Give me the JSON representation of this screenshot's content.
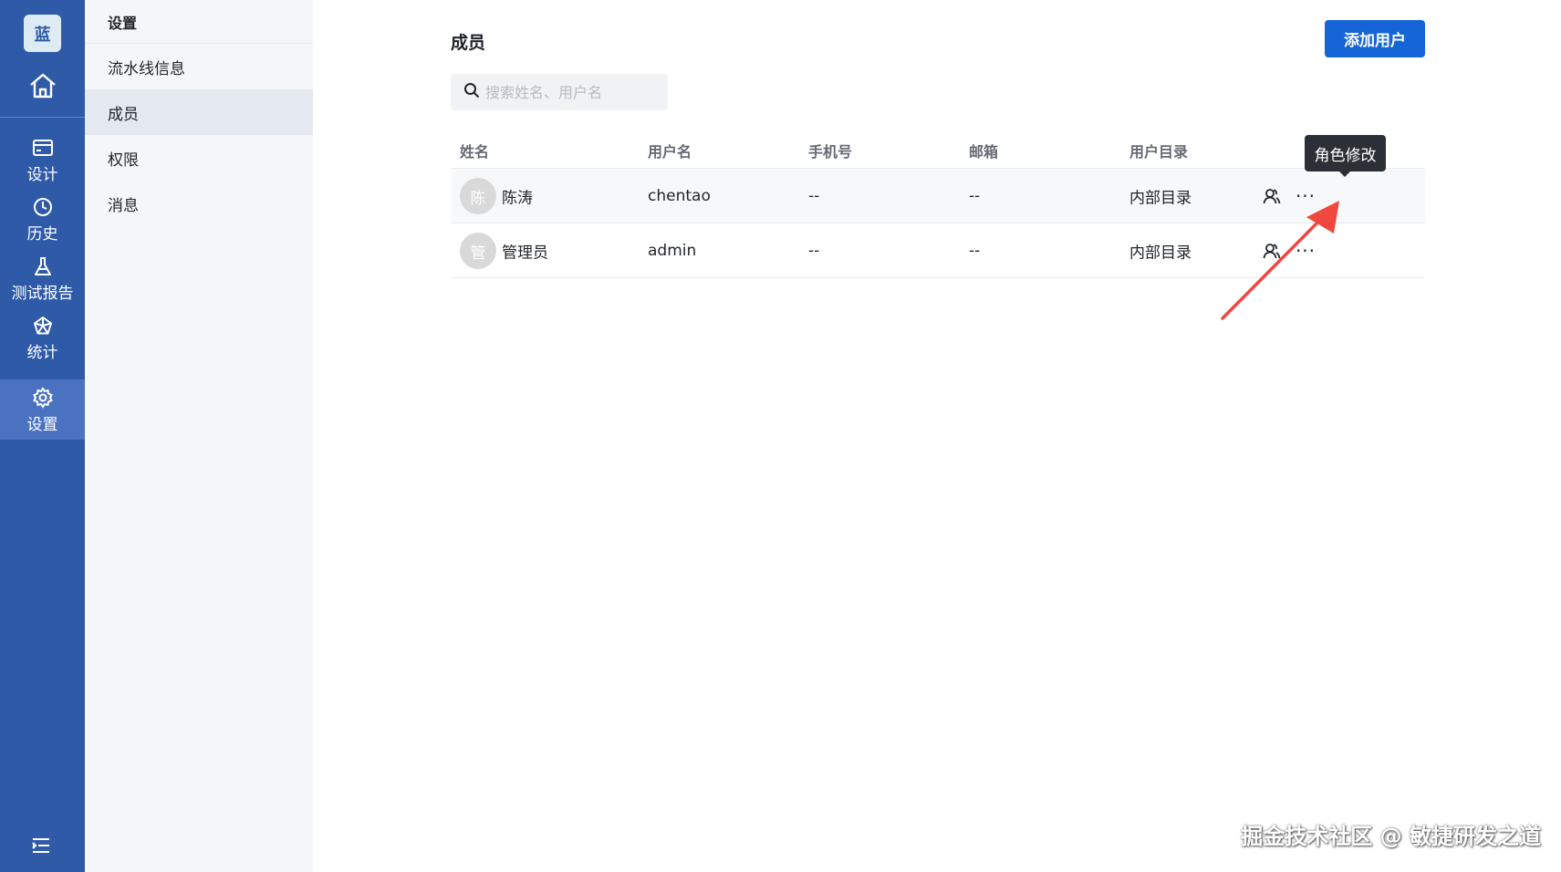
{
  "rail": {
    "logo": "蓝",
    "items": [
      {
        "label": "设计",
        "icon": "card-icon"
      },
      {
        "label": "历史",
        "icon": "clock-icon"
      },
      {
        "label": "测试报告",
        "icon": "flask-icon"
      },
      {
        "label": "统计",
        "icon": "pentagon-chart-icon"
      },
      {
        "label": "设置",
        "icon": "gear-icon",
        "active": true
      }
    ]
  },
  "sidebar": {
    "title": "设置",
    "items": [
      {
        "label": "流水线信息"
      },
      {
        "label": "成员",
        "active": true
      },
      {
        "label": "权限"
      },
      {
        "label": "消息"
      }
    ]
  },
  "main": {
    "title": "成员",
    "add_button": "添加用户",
    "search_placeholder": "搜索姓名、用户名",
    "columns": [
      "姓名",
      "用户名",
      "手机号",
      "邮箱",
      "用户目录"
    ],
    "rows": [
      {
        "avatar": "陈",
        "name": "陈涛",
        "username": "chentao",
        "phone": "--",
        "email": "--",
        "directory": "内部目录"
      },
      {
        "avatar": "管",
        "name": "管理员",
        "username": "admin",
        "phone": "--",
        "email": "--",
        "directory": "内部目录"
      }
    ],
    "tooltip": "角色修改"
  },
  "watermark": "掘金技术社区 @ 敏捷研发之道",
  "colors": {
    "rail_bg": "#2f5aa8",
    "primary": "#1565d8",
    "arrow": "#f0483e"
  }
}
